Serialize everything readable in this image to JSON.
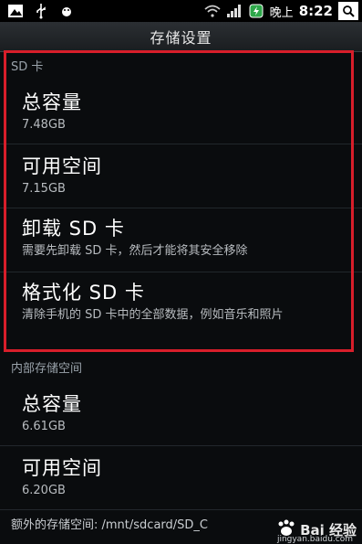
{
  "status_bar": {
    "icons": [
      "image-app-icon",
      "usb-icon",
      "android-debug-icon",
      "wifi-icon",
      "signal-icon",
      "battery-icon"
    ],
    "time_ampm": "晚上",
    "time": "8:22"
  },
  "title": "存储设置",
  "sd_card": {
    "header": "SD 卡",
    "items": [
      {
        "title": "总容量",
        "sub": "7.48GB"
      },
      {
        "title": "可用空间",
        "sub": "7.15GB"
      },
      {
        "title": "卸载 SD 卡",
        "sub": "需要先卸载 SD 卡，然后才能将其安全移除"
      },
      {
        "title": "格式化 SD 卡",
        "sub": "清除手机的 SD 卡中的全部数据，例如音乐和照片"
      }
    ]
  },
  "internal": {
    "header": "内部存储空间",
    "items": [
      {
        "title": "总容量",
        "sub": "6.61GB"
      },
      {
        "title": "可用空间",
        "sub": "6.20GB"
      }
    ]
  },
  "footer": {
    "text": "额外的存储空间: /mnt/sdcard/SD_C"
  },
  "watermark": {
    "text": "Bai 经验",
    "sub": "jingyan.baidu.com"
  },
  "colors": {
    "highlight_border": "#d81e2a",
    "background": "#0a0c0e"
  }
}
